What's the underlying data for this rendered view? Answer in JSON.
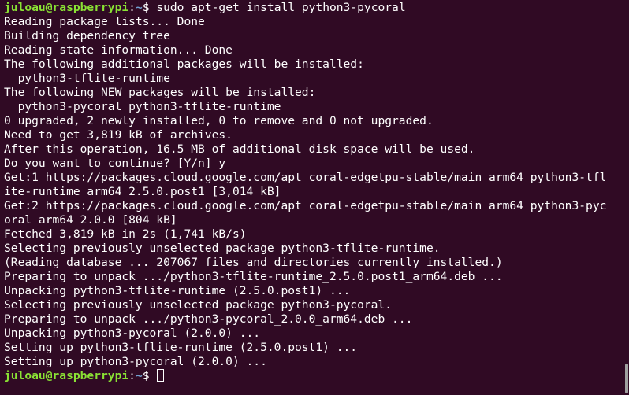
{
  "colors": {
    "background": "#300a24",
    "text": "#ffffff",
    "prompt_user": "#8ae234",
    "prompt_path": "#729fcf"
  },
  "prompt": {
    "user_host": "juloau@raspberrypi",
    "separator": ":",
    "path": "~",
    "symbol": "$ "
  },
  "command": "sudo apt-get install python3-pycoral",
  "output_lines": [
    "Reading package lists... Done",
    "Building dependency tree",
    "Reading state information... Done",
    "The following additional packages will be installed:",
    "  python3-tflite-runtime",
    "The following NEW packages will be installed:",
    "  python3-pycoral python3-tflite-runtime",
    "0 upgraded, 2 newly installed, 0 to remove and 0 not upgraded.",
    "Need to get 3,819 kB of archives.",
    "After this operation, 16.5 MB of additional disk space will be used.",
    "Do you want to continue? [Y/n] y",
    "Get:1 https://packages.cloud.google.com/apt coral-edgetpu-stable/main arm64 python3-tfl",
    "ite-runtime arm64 2.5.0.post1 [3,014 kB]",
    "Get:2 https://packages.cloud.google.com/apt coral-edgetpu-stable/main arm64 python3-pyc",
    "oral arm64 2.0.0 [804 kB]",
    "Fetched 3,819 kB in 2s (1,741 kB/s)",
    "Selecting previously unselected package python3-tflite-runtime.",
    "(Reading database ... 207067 files and directories currently installed.)",
    "Preparing to unpack .../python3-tflite-runtime_2.5.0.post1_arm64.deb ...",
    "Unpacking python3-tflite-runtime (2.5.0.post1) ...",
    "Selecting previously unselected package python3-pycoral.",
    "Preparing to unpack .../python3-pycoral_2.0.0_arm64.deb ...",
    "Unpacking python3-pycoral (2.0.0) ...",
    "Setting up python3-tflite-runtime (2.5.0.post1) ...",
    "Setting up python3-pycoral (2.0.0) ..."
  ]
}
